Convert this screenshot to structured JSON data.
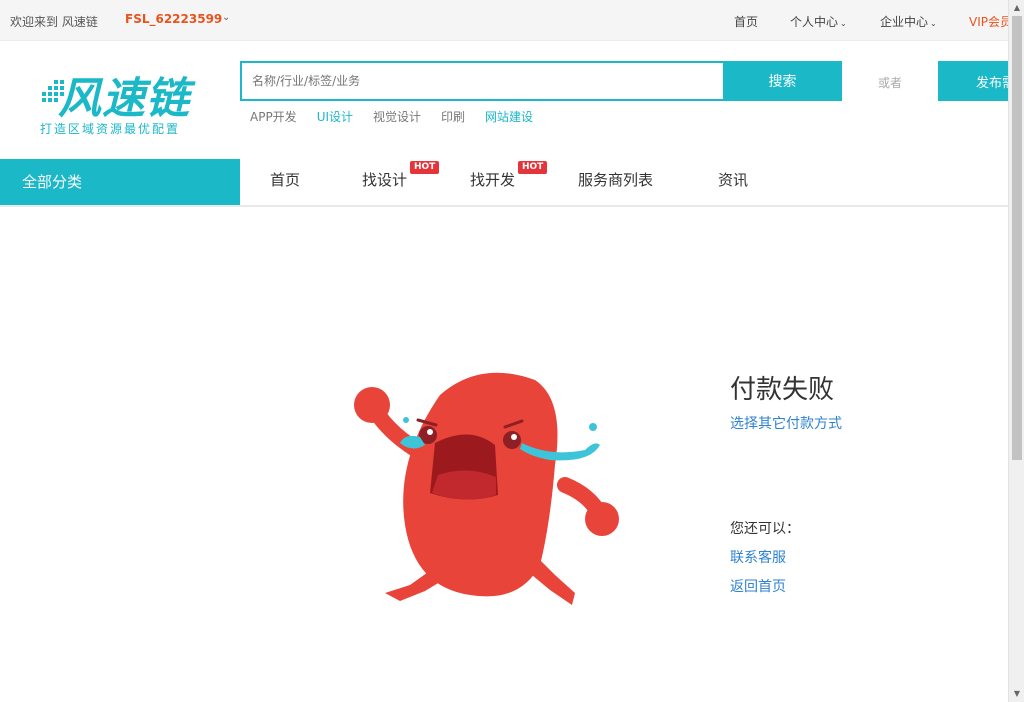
{
  "topbar": {
    "welcome": "欢迎来到 风速链",
    "username": "FSL_62223599",
    "links": {
      "home": "首页",
      "personal": "个人中心",
      "enterprise": "企业中心",
      "vip": "VIP会员"
    }
  },
  "header": {
    "logo_text": "风速链",
    "slogan": "打造区域资源最优配置",
    "search": {
      "placeholder": "名称/行业/标签/业务",
      "button": "搜索"
    },
    "or_text": "或者",
    "publish_button": "发布需求",
    "hot_tags": [
      {
        "label": "APP开发"
      },
      {
        "label": "UI设计"
      },
      {
        "label": "视觉设计"
      },
      {
        "label": "印刷"
      },
      {
        "label": "网站建设"
      }
    ]
  },
  "nav": {
    "all_categories": "全部分类",
    "items": [
      {
        "label": "首页"
      },
      {
        "label": "找设计",
        "badge": "HOT"
      },
      {
        "label": "找开发",
        "badge": "HOT"
      },
      {
        "label": "服务商列表"
      },
      {
        "label": "资讯"
      }
    ]
  },
  "main": {
    "title": "付款失败",
    "choose_other": "选择其它付款方式",
    "also_label": "您还可以：",
    "contact": "联系客服",
    "back_home": "返回首页"
  },
  "colors": {
    "accent": "#1bb8c8",
    "username": "#e8541e",
    "link": "#2f83d1",
    "hot": "#e6353a",
    "mascot": "#e8443a"
  }
}
